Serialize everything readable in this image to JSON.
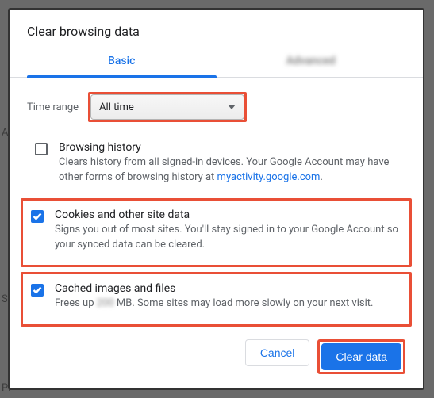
{
  "dialog": {
    "title": "Clear browsing data",
    "tabs": {
      "basic": "Basic",
      "advanced": "Advanced"
    },
    "timerange": {
      "label": "Time range",
      "value": "All time"
    },
    "options": {
      "history": {
        "title": "Browsing history",
        "desc_pre": "Clears history from all signed-in devices. Your Google Account may have other forms of browsing history at ",
        "link_text": "myactivity.google.com",
        "desc_post": ".",
        "checked": false
      },
      "cookies": {
        "title": "Cookies and other site data",
        "desc": "Signs you out of most sites. You'll stay signed in to your Google Account so your synced data can be cleared.",
        "checked": true
      },
      "cache": {
        "title": "Cached images and files",
        "desc_pre": "Frees up ",
        "blurred_value": "200",
        "desc_post": " MB. Some sites may load more slowly on your next visit.",
        "checked": true
      }
    },
    "buttons": {
      "cancel": "Cancel",
      "clear": "Clear data"
    }
  },
  "background_labels": {
    "a": "Au",
    "s": "Sa",
    "p": "Pr"
  }
}
